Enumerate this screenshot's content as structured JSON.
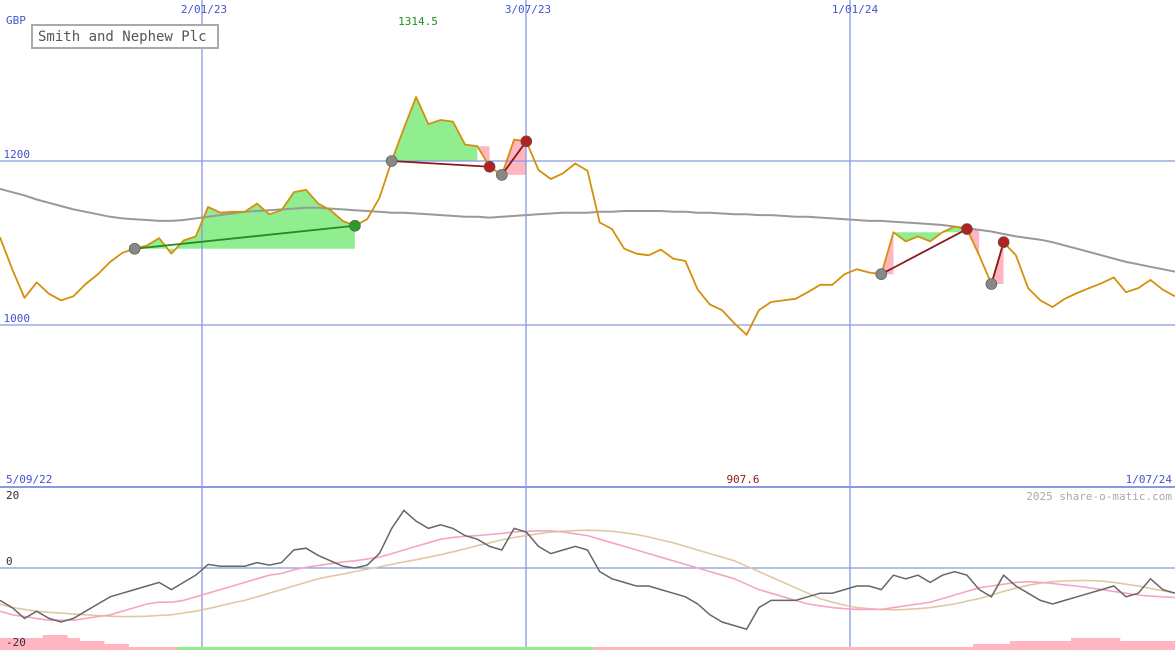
{
  "chart_data": [
    {
      "type": "line",
      "title": "Smith and Nephew Plc",
      "currency": "GBP",
      "x_start_label": "5/09/22",
      "x_end_label": "1/07/24",
      "x_tick_labels": [
        "2/01/23",
        "3/07/23",
        "1/01/24"
      ],
      "y_tick_labels": [
        "1200",
        "1000"
      ],
      "high_label": "1314.5",
      "low_label": "907.6",
      "watermark": "2025 share-o-matic.com",
      "ylim": [
        907.6,
        1314.5
      ],
      "colors": {
        "price": "#d4900a",
        "moving_average": "#999999",
        "gain_fill": "#90ee90",
        "loss_fill": "#ffb6c1",
        "up_trend": "#228b22",
        "down_trend": "#8b1a1a",
        "grid": "#8899dd"
      },
      "series": [
        {
          "key": "price",
          "values": [
            1107,
            1068,
            1033,
            1052,
            1038,
            1030,
            1035,
            1050,
            1062,
            1077,
            1088,
            1093,
            1097,
            1106,
            1087,
            1103,
            1108,
            1144,
            1137,
            1138,
            1138,
            1148,
            1135,
            1140,
            1162,
            1165,
            1148,
            1140,
            1127,
            1121,
            1129,
            1155,
            1200,
            1240,
            1278,
            1245,
            1250,
            1248,
            1220,
            1218,
            1193,
            1183,
            1226,
            1224,
            1189,
            1178,
            1185,
            1197,
            1188,
            1125,
            1117,
            1093,
            1087,
            1085,
            1092,
            1081,
            1078,
            1043,
            1025,
            1018,
            1002,
            988,
            1018,
            1028,
            1030,
            1032,
            1040,
            1049,
            1049,
            1062,
            1068,
            1064,
            1062,
            1113,
            1102,
            1108,
            1102,
            1113,
            1120,
            1117,
            1085,
            1050,
            1101,
            1085,
            1045,
            1030,
            1022,
            1032,
            1039,
            1045,
            1051,
            1058,
            1040,
            1045,
            1055,
            1043,
            1035
          ]
        },
        {
          "key": "moving_average",
          "values": [
            1166,
            1162,
            1158,
            1153,
            1149,
            1145,
            1141,
            1138,
            1135,
            1132,
            1130,
            1129,
            1128,
            1127,
            1127,
            1128,
            1130,
            1132,
            1134,
            1136,
            1138,
            1139,
            1140,
            1141,
            1142,
            1143,
            1143,
            1142,
            1141,
            1140,
            1139,
            1138,
            1137,
            1137,
            1136,
            1135,
            1134,
            1133,
            1132,
            1132,
            1131,
            1132,
            1133,
            1134,
            1135,
            1136,
            1137,
            1137,
            1137,
            1138,
            1138,
            1139,
            1139,
            1139,
            1139,
            1138,
            1138,
            1137,
            1137,
            1136,
            1135,
            1135,
            1134,
            1134,
            1133,
            1132,
            1132,
            1131,
            1130,
            1129,
            1128,
            1127,
            1127,
            1126,
            1125,
            1124,
            1123,
            1122,
            1120,
            1118,
            1116,
            1114,
            1111,
            1108,
            1106,
            1104,
            1101,
            1097,
            1093,
            1089,
            1085,
            1081,
            1077,
            1074,
            1071,
            1068,
            1065
          ]
        }
      ],
      "fills": [
        {
          "kind": "gain",
          "start": 11,
          "end": 29
        },
        {
          "kind": "gain",
          "start": 32,
          "end": 39
        },
        {
          "kind": "loss",
          "start": 39,
          "end": 40
        },
        {
          "kind": "loss",
          "start": 41,
          "end": 43
        },
        {
          "kind": "loss",
          "start": 72,
          "end": 73
        },
        {
          "kind": "gain",
          "start": 73,
          "end": 79
        },
        {
          "kind": "loss",
          "start": 79,
          "end": 80
        },
        {
          "kind": "loss",
          "start": 81,
          "end": 82
        }
      ],
      "trend_lines": [
        {
          "kind": "up",
          "from": 11,
          "to": 29
        },
        {
          "kind": "down",
          "from": 32,
          "to": 40
        },
        {
          "kind": "down",
          "from": 41,
          "to": 43
        },
        {
          "kind": "down",
          "from": 72,
          "to": 79
        },
        {
          "kind": "down",
          "from": 81,
          "to": 82
        }
      ],
      "markers": [
        {
          "index": 11,
          "kind": "start"
        },
        {
          "index": 29,
          "kind": "up"
        },
        {
          "index": 32,
          "kind": "start"
        },
        {
          "index": 40,
          "kind": "down"
        },
        {
          "index": 41,
          "kind": "start"
        },
        {
          "index": 43,
          "kind": "down"
        },
        {
          "index": 72,
          "kind": "start"
        },
        {
          "index": 79,
          "kind": "down"
        },
        {
          "index": 81,
          "kind": "start"
        },
        {
          "index": 82,
          "kind": "down"
        }
      ]
    },
    {
      "type": "line",
      "y_tick_labels": [
        "20",
        "0",
        "-20"
      ],
      "ylim": [
        -20,
        20
      ],
      "colors": {
        "oscillator": "#666666",
        "signal_fast": "#f4a6c0",
        "signal_slow": "#e0c8a0",
        "hist_pos": "#90ee90",
        "hist_neg": "#ffb6c1"
      },
      "series": [
        {
          "key": "oscillator",
          "values": [
            -9,
            -11,
            -14,
            -12,
            -14,
            -15,
            -14,
            -12,
            -10,
            -8,
            -7,
            -6,
            -5,
            -4,
            -6,
            -4,
            -2,
            1,
            0.5,
            0.5,
            0.5,
            1.5,
            0.8,
            1.5,
            5,
            5.5,
            3.5,
            2,
            0.5,
            0,
            0.8,
            4,
            11,
            16,
            13,
            11,
            12,
            11,
            9,
            8,
            6,
            5,
            11,
            10,
            6,
            4,
            5,
            6,
            5,
            -1,
            -3,
            -4,
            -5,
            -5,
            -6,
            -7,
            -8,
            -10,
            -13,
            -15,
            -16,
            -17,
            -11,
            -9,
            -9,
            -9,
            -8,
            -7,
            -7,
            -6,
            -5,
            -5,
            -6,
            -2,
            -3,
            -2,
            -4,
            -2,
            -1,
            -2,
            -6,
            -8,
            -2,
            -5,
            -7,
            -9,
            -10,
            -9,
            -8,
            -7,
            -6,
            -5,
            -8,
            -7,
            -3,
            -6,
            -7
          ]
        },
        {
          "key": "signal_fast",
          "values": [
            -12,
            -13,
            -13.5,
            -14,
            -14.5,
            -14.5,
            -14.5,
            -14,
            -13.5,
            -13,
            -12,
            -11,
            -10,
            -9.5,
            -9.5,
            -9,
            -8,
            -7,
            -6,
            -5,
            -4,
            -3,
            -2,
            -1.5,
            -0.5,
            0.2,
            0.7,
            1.2,
            1.7,
            2,
            2.5,
            3,
            4,
            5,
            6,
            7,
            8,
            8.5,
            8.8,
            9,
            9.3,
            9.6,
            10,
            10.2,
            10.3,
            10.3,
            10,
            9.5,
            9,
            8,
            7,
            6,
            5,
            4,
            3,
            2,
            1,
            0,
            -1,
            -2,
            -3,
            -4.5,
            -6,
            -7,
            -8,
            -9,
            -10,
            -10.5,
            -11,
            -11.3,
            -11.5,
            -11.5,
            -11.5,
            -11,
            -10.5,
            -10,
            -9.5,
            -8.5,
            -7.5,
            -6.5,
            -5.5,
            -5,
            -4.5,
            -4,
            -3.8,
            -4,
            -4.3,
            -4.7,
            -5,
            -5.5,
            -6,
            -6.5,
            -7,
            -7.5,
            -7.8,
            -8,
            -8.2
          ]
        },
        {
          "key": "signal_slow",
          "values": [
            -10,
            -11,
            -11.5,
            -12,
            -12.3,
            -12.5,
            -12.8,
            -13,
            -13.2,
            -13.4,
            -13.5,
            -13.5,
            -13.4,
            -13.2,
            -13,
            -12.5,
            -12,
            -11.3,
            -10.5,
            -9.7,
            -9,
            -8,
            -7,
            -6,
            -5,
            -4,
            -3,
            -2.3,
            -1.7,
            -1,
            -0.3,
            0.3,
            1,
            1.7,
            2.3,
            3,
            3.7,
            4.5,
            5.3,
            6.2,
            7,
            7.8,
            8.5,
            9,
            9.5,
            10,
            10.2,
            10.4,
            10.5,
            10.4,
            10.2,
            9.8,
            9.3,
            8.6,
            7.8,
            7,
            6,
            5,
            4,
            3,
            2,
            0.5,
            -1,
            -2.5,
            -4,
            -5.5,
            -7,
            -8.5,
            -9.5,
            -10.3,
            -11,
            -11.3,
            -11.5,
            -11.6,
            -11.5,
            -11.3,
            -11,
            -10.5,
            -10,
            -9.2,
            -8.5,
            -7.5,
            -6.5,
            -5.6,
            -4.8,
            -4.2,
            -3.8,
            -3.6,
            -3.5,
            -3.5,
            -3.6,
            -4,
            -4.5,
            -5,
            -5.7,
            -6.3,
            -7
          ]
        },
        {
          "key": "histogram",
          "values": [
            -4,
            -4,
            -4,
            -4,
            -5,
            -5,
            -4,
            -3,
            -3,
            -2,
            -2,
            -1,
            -1,
            -1,
            -1,
            1,
            1,
            1,
            1,
            1,
            1,
            1,
            1,
            1,
            1,
            1,
            1,
            1,
            1,
            1,
            1,
            1,
            1,
            1,
            1,
            1,
            1,
            1,
            1,
            1,
            1,
            1,
            1,
            1,
            1,
            1,
            1,
            1,
            1,
            -1,
            -1,
            -1,
            -1,
            -1,
            -1,
            -1,
            -1,
            -1,
            -1,
            -1,
            -1,
            -1,
            -1,
            -1,
            -1,
            -1,
            -1,
            -1,
            -1,
            -1,
            -1,
            -1,
            -1,
            -1,
            -1,
            -1,
            -1,
            -1,
            -1,
            -1,
            -2,
            -2,
            -2,
            -3,
            -3,
            -3,
            -3,
            -3,
            -4,
            -4,
            -4,
            -4,
            -3,
            -3,
            -3,
            -3,
            -3
          ]
        }
      ]
    }
  ]
}
